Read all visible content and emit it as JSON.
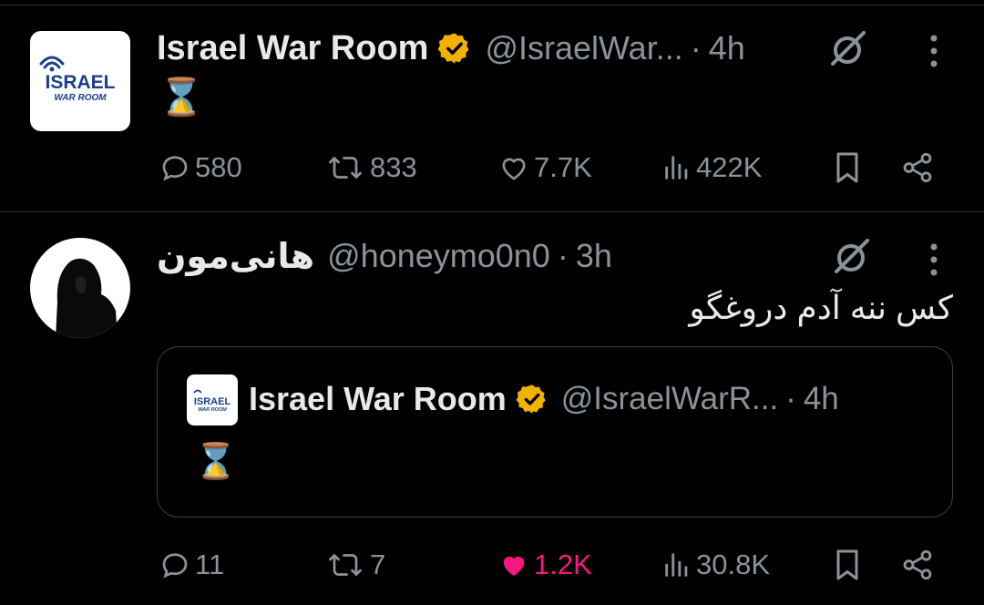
{
  "tweets": [
    {
      "author": {
        "name": "Israel War Room",
        "handle": "@IsraelWar...",
        "verified": true,
        "avatar_text": [
          "ISRAEL",
          "WAR ROOM"
        ]
      },
      "time": "4h",
      "sep": "·",
      "body": "⌛",
      "stats": {
        "replies": "580",
        "reposts": "833",
        "likes": "7.7K",
        "views": "422K"
      },
      "liked": false
    },
    {
      "author": {
        "name": "هانی‌مون",
        "handle": "@honeymo0n0",
        "verified": false
      },
      "time": "3h",
      "sep": "·",
      "body": "کس ننه آدم دروغگو",
      "quote": {
        "author": {
          "name": "Israel War Room",
          "handle": "@IsraelWarR...",
          "verified": true,
          "avatar_text": [
            "ISRAEL",
            "WAR ROOM"
          ]
        },
        "time": "4h",
        "sep": "·",
        "body": "⌛"
      },
      "stats": {
        "replies": "11",
        "reposts": "7",
        "likes": "1.2K",
        "views": "30.8K"
      },
      "liked": true
    }
  ],
  "colors": {
    "background": "#000000",
    "text": "#e7e9ea",
    "muted": "#8b9299",
    "like": "#f91880",
    "verified": "#f2b200",
    "brand_blue": "#1a3f8f"
  },
  "icons": [
    "verified-badge-icon",
    "grok-icon",
    "more-icon",
    "reply-icon",
    "repost-icon",
    "like-icon",
    "views-icon",
    "bookmark-icon",
    "share-icon"
  ]
}
